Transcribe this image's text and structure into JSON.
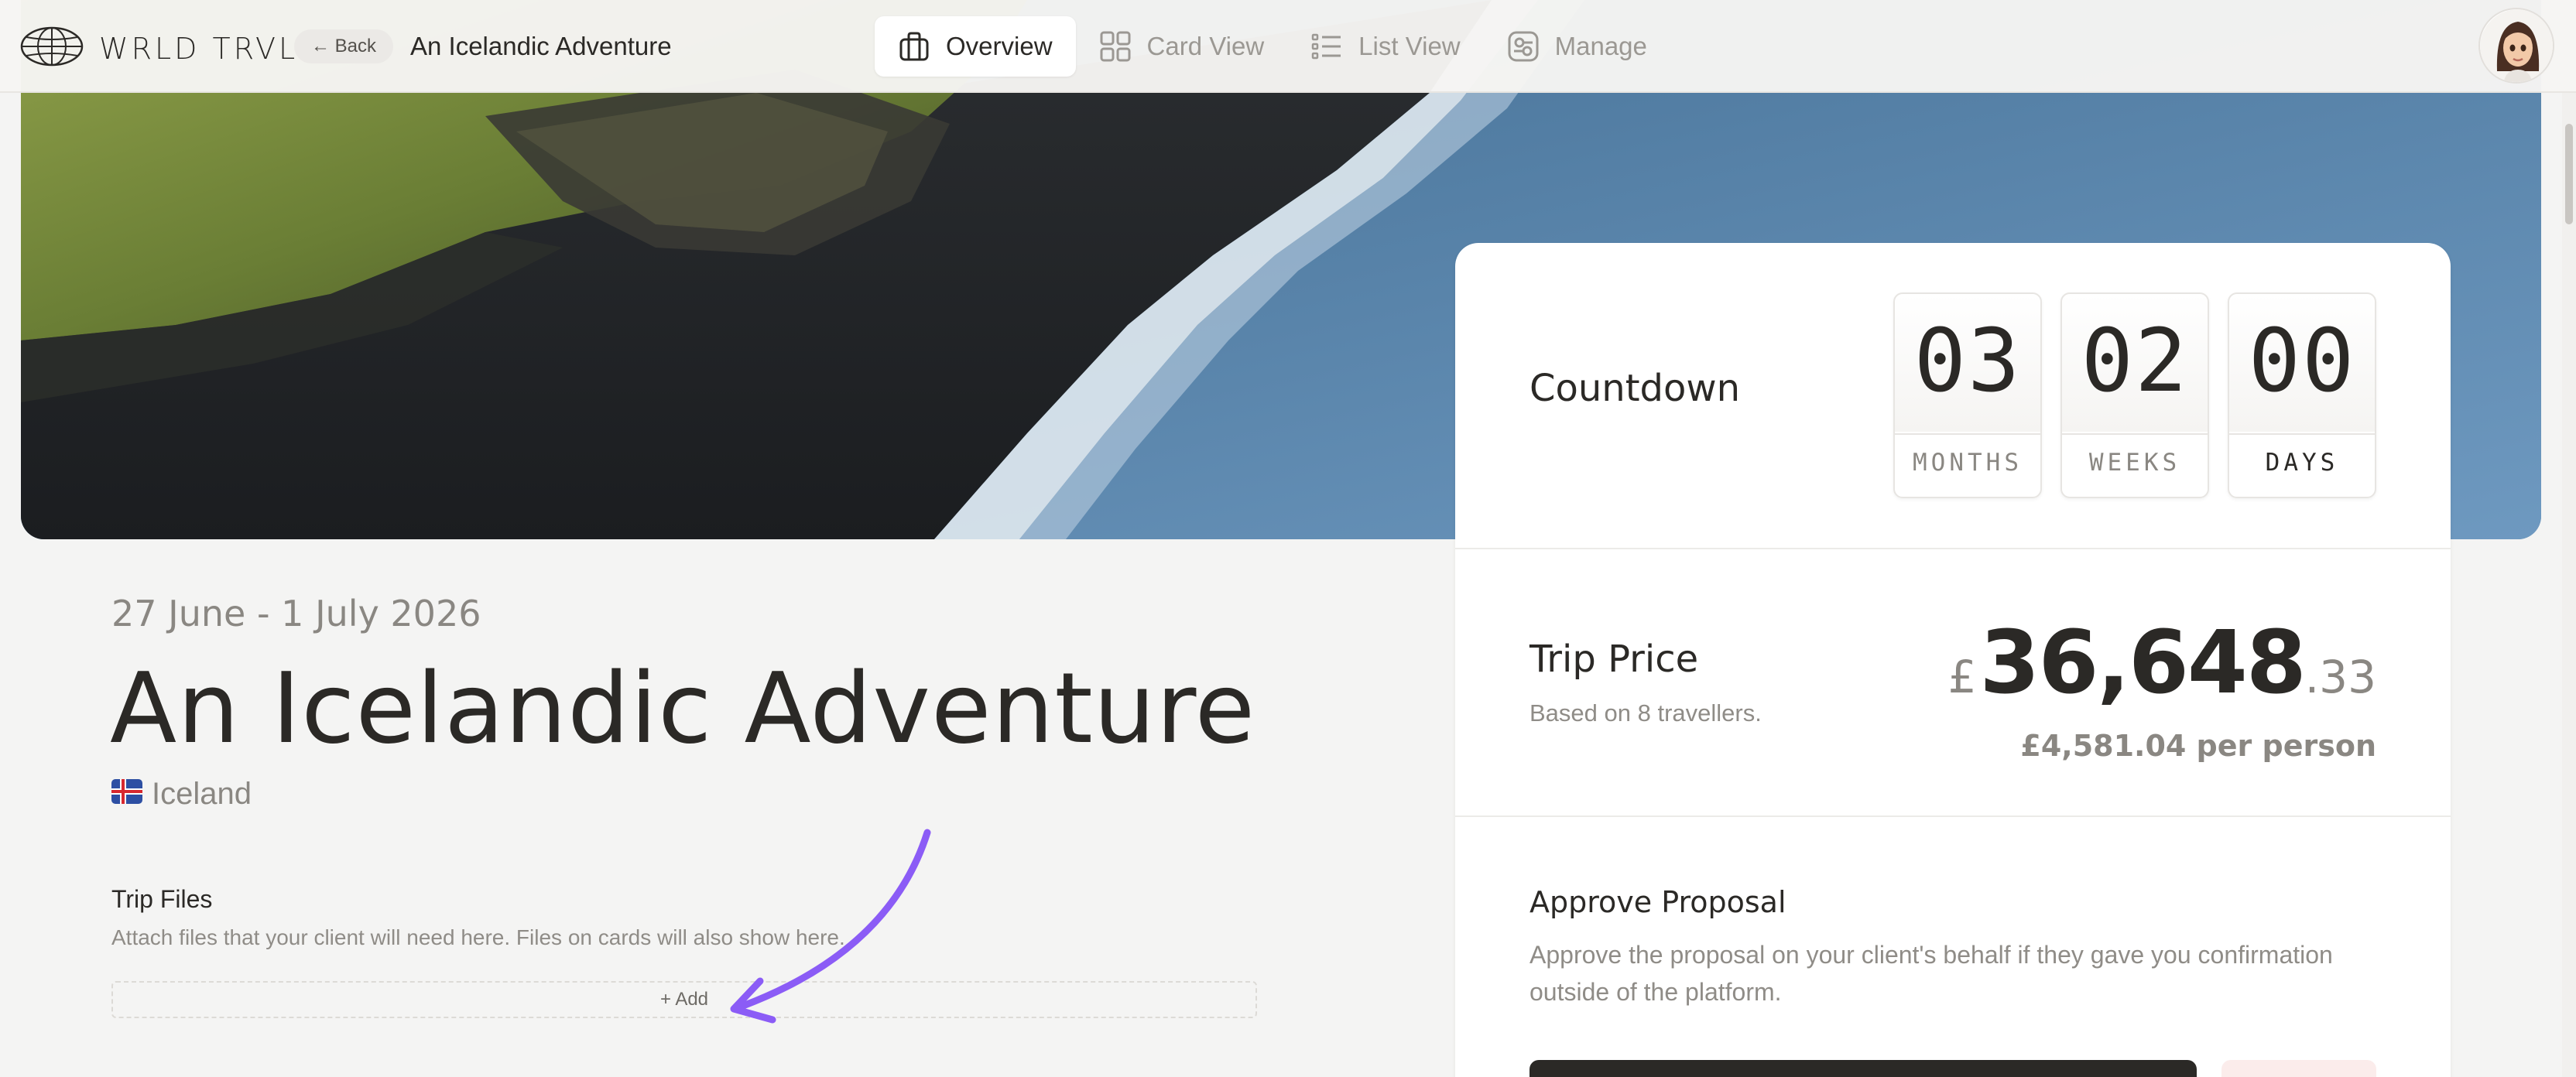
{
  "brand": {
    "name": "WRLD TRVL"
  },
  "nav": {
    "back_label": "← Back",
    "page_title": "An Icelandic Adventure",
    "tabs": [
      {
        "label": "Overview",
        "icon": "briefcase-icon",
        "active": true
      },
      {
        "label": "Card View",
        "icon": "grid-icon",
        "active": false
      },
      {
        "label": "List View",
        "icon": "list-icon",
        "active": false
      },
      {
        "label": "Manage",
        "icon": "settings-panel-icon",
        "active": false
      }
    ]
  },
  "trip": {
    "dates": "27 June - 1 July 2026",
    "title": "An Icelandic Adventure",
    "country": "Iceland"
  },
  "files": {
    "title": "Trip Files",
    "description": "Attach files that your client will need here. Files on cards will also show here.",
    "add_label": "+ Add"
  },
  "countdown": {
    "label": "Countdown",
    "units": [
      {
        "value": "03",
        "unit": "MONTHS"
      },
      {
        "value": "02",
        "unit": "WEEKS"
      },
      {
        "value": "00",
        "unit": "DAYS"
      }
    ]
  },
  "price": {
    "label": "Trip Price",
    "subtitle": "Based on 8 travellers.",
    "currency": "£",
    "whole": "36,648",
    "decimal": ".33",
    "per_person": "£4,581.04 per person"
  },
  "approve": {
    "title": "Approve Proposal",
    "description": "Approve the proposal on your client's behalf if they gave you confirmation outside of the platform."
  },
  "colors": {
    "accent_arrow": "#8b5cf6",
    "text_dark": "#2b2926",
    "text_muted": "#8f8c87"
  }
}
